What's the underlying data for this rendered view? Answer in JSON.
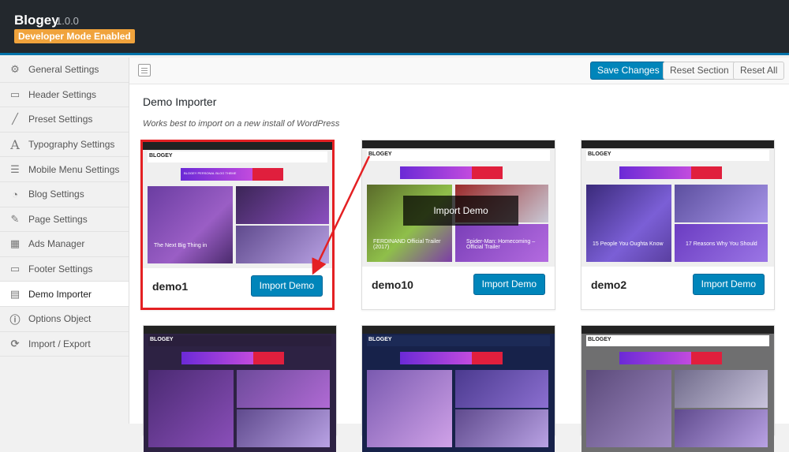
{
  "app": {
    "title": "Blogey",
    "version": "1.0.0",
    "mode_badge": "Developer Mode Enabled"
  },
  "sidebar": {
    "items": [
      {
        "label": "General Settings",
        "icon": "gears-icon"
      },
      {
        "label": "Header Settings",
        "icon": "monitor-icon"
      },
      {
        "label": "Preset Settings",
        "icon": "brush-icon"
      },
      {
        "label": "Typography Settings",
        "icon": "font-icon"
      },
      {
        "label": "Mobile Menu Settings",
        "icon": "menu-icon"
      },
      {
        "label": "Blog Settings",
        "icon": "blog-icon"
      },
      {
        "label": "Page Settings",
        "icon": "page-icon"
      },
      {
        "label": "Ads Manager",
        "icon": "qr-icon"
      },
      {
        "label": "Footer Settings",
        "icon": "monitor-icon"
      },
      {
        "label": "Demo Importer",
        "icon": "import-icon",
        "active": true
      },
      {
        "label": "Options Object",
        "icon": "info-icon"
      },
      {
        "label": "Import / Export",
        "icon": "refresh-icon"
      }
    ]
  },
  "toolbar": {
    "save_label": "Save Changes",
    "reset_section_label": "Reset Section",
    "reset_all_label": "Reset All"
  },
  "content": {
    "title": "Demo Importer",
    "subtitle": "Works best to import on a new install of WordPress",
    "demos": [
      {
        "name": "demo1",
        "button": "Import Demo",
        "highlight": true
      },
      {
        "name": "demo10",
        "button": "Import Demo",
        "overlay": "Import Demo"
      },
      {
        "name": "demo2",
        "button": "Import Demo"
      }
    ],
    "preview_texts": {
      "logo": "BLOGEY",
      "ad": "BLOGEY PERSONAL BLOG THEME",
      "d1_main": "The Next Big Thing in",
      "d10_left": "FERDINAND Official Trailer (2017)",
      "d10_right": "Spider-Man: Homecoming – Official Trailer",
      "d2_left": "15 People You Oughta Know",
      "d2_right": "17 Reasons Why You Should"
    }
  },
  "colors": {
    "accent": "#0085ba",
    "highlight": "#e42023",
    "badge": "#f0a33c"
  }
}
